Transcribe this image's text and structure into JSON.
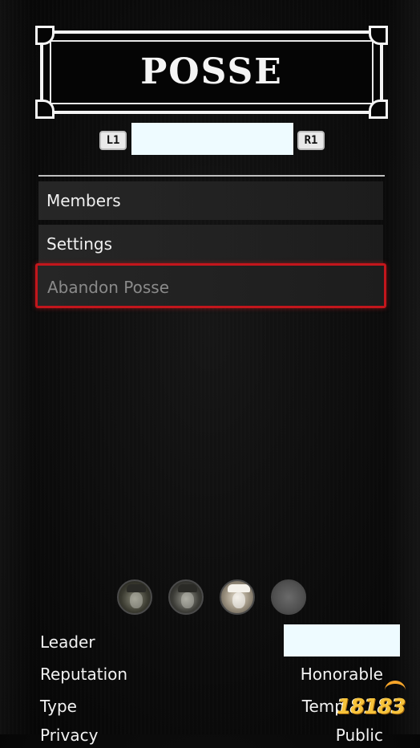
{
  "header": {
    "title": "POSSE"
  },
  "tabs": {
    "left_button": "L1",
    "right_button": "R1",
    "current_tab": ""
  },
  "menu": {
    "items": [
      {
        "label": "Members"
      },
      {
        "label": "Settings"
      },
      {
        "label": "Abandon Posse",
        "selected": true
      }
    ]
  },
  "members": {
    "avatars": [
      {
        "icon": "member-avatar-icon"
      },
      {
        "icon": "member-avatar-icon"
      },
      {
        "icon": "member-avatar-icon"
      },
      {
        "icon": "empty-slot-icon"
      }
    ]
  },
  "info": {
    "leader_label": "Leader",
    "leader_value": "",
    "reputation_label": "Reputation",
    "reputation_value": "Honorable",
    "type_label": "Type",
    "type_value": "Temp",
    "privacy_label": "Privacy",
    "privacy_value": "Public"
  },
  "watermark": {
    "text": "18183"
  },
  "colors": {
    "selection_border": "#c3161c",
    "background": "#0b0b0b",
    "text": "#f2f2f2",
    "watermark": "#f7c33a"
  }
}
